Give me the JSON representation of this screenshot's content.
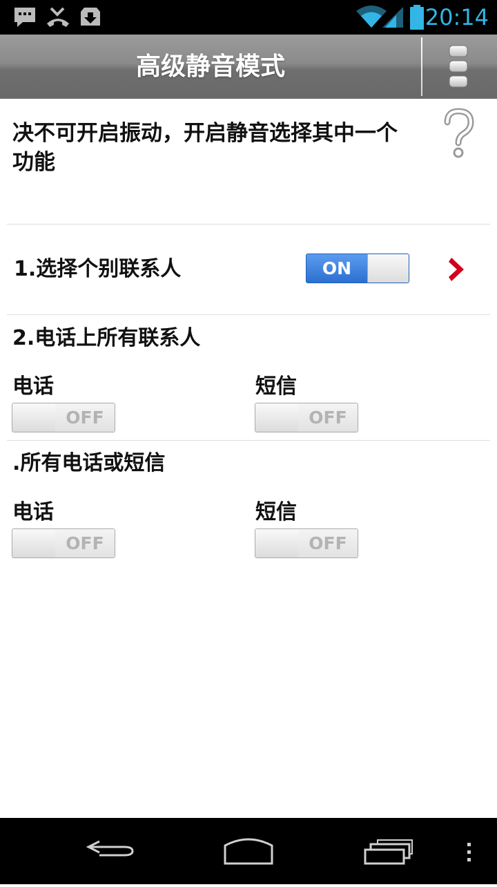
{
  "status_bar": {
    "time": "20:14",
    "icons": [
      "message-icon",
      "missed-call-icon",
      "download-icon",
      "wifi-icon",
      "signal-icon",
      "battery-icon"
    ],
    "accent_color": "#33b5e5"
  },
  "action_bar": {
    "title": "高级静音模式",
    "menu_icon": "overflow-menu-icon"
  },
  "description": "决不可开启振动，开启静音选择其中一个功能",
  "help_icon": "question-mark-icon",
  "section1": {
    "label": "1.选择个别联系人",
    "toggle": {
      "state": "ON",
      "on": true
    },
    "chevron_color": "#d0021b"
  },
  "section2": {
    "title": "2.电话上所有联系人",
    "phone_label": "电话",
    "phone_toggle": {
      "state": "OFF",
      "on": false
    },
    "sms_label": "短信",
    "sms_toggle": {
      "state": "OFF",
      "on": false
    }
  },
  "section3": {
    "title": ".所有电话或短信",
    "phone_label": "电话",
    "phone_toggle": {
      "state": "OFF",
      "on": false
    },
    "sms_label": "短信",
    "sms_toggle": {
      "state": "OFF",
      "on": false
    }
  },
  "nav_bar": {
    "buttons": [
      "back-icon",
      "home-icon",
      "recent-apps-icon",
      "menu-dots-icon"
    ]
  }
}
